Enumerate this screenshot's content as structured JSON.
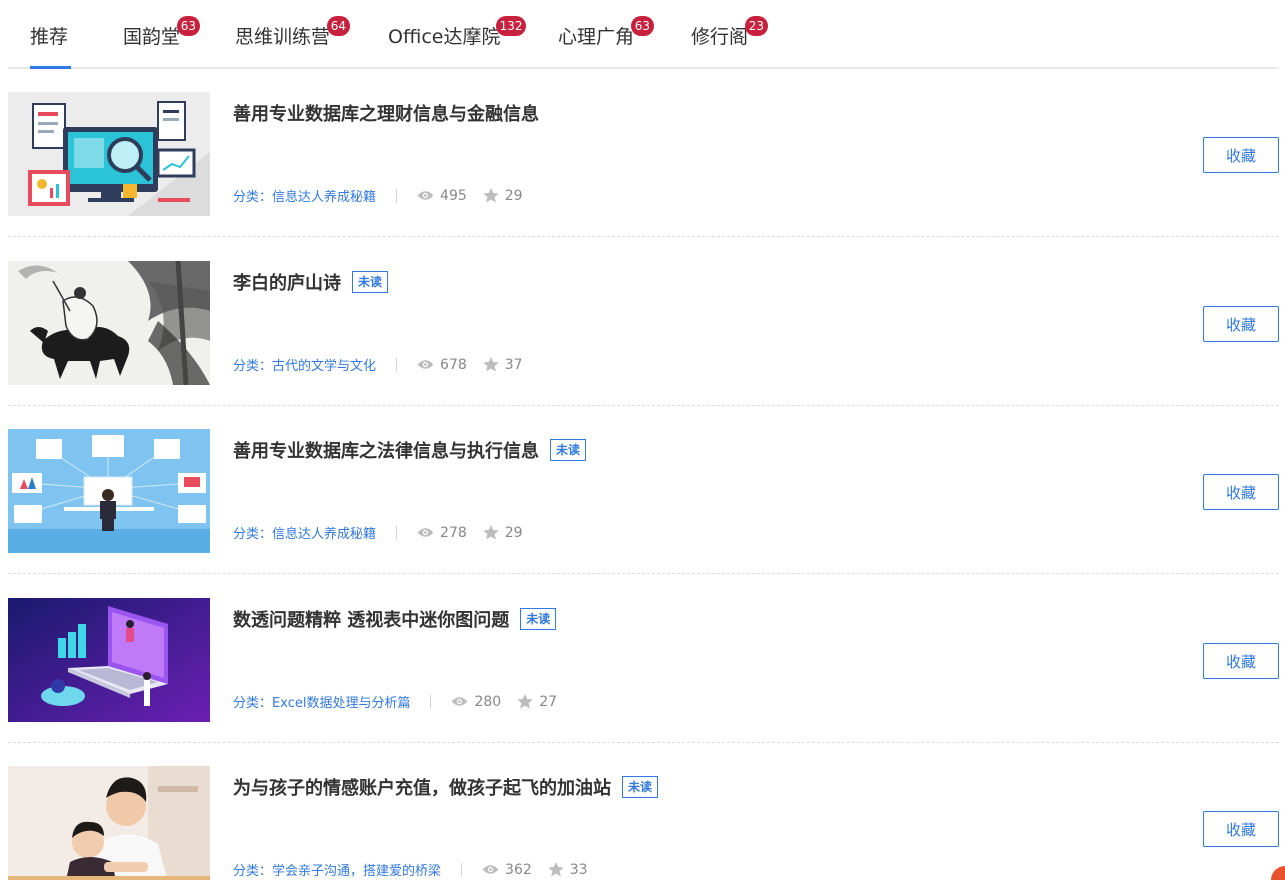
{
  "tabs": [
    {
      "label": "推荐",
      "badge": ""
    },
    {
      "label": "国韵堂",
      "badge": "63"
    },
    {
      "label": "思维训练营",
      "badge": "64"
    },
    {
      "label": "Office达摩院",
      "badge": "132"
    },
    {
      "label": "心理广角",
      "badge": "63"
    },
    {
      "label": "修行阁",
      "badge": "23"
    }
  ],
  "active_tab": "推荐",
  "accent_color": "#3279e3",
  "badge_color": "#c8213d",
  "icons": {
    "views": "eye-icon",
    "favorites": "star-icon"
  },
  "articles": [
    {
      "title": "善用专业数据库之理财信息与金融信息",
      "unread_label": "",
      "category_label": "分类：",
      "category": "信息达人养成秘籍",
      "views": "495",
      "favorites": "29",
      "button": "收藏"
    },
    {
      "title": "李白的庐山诗",
      "unread_label": "未读",
      "category_label": "分类：",
      "category": "古代的文学与文化",
      "views": "678",
      "favorites": "37",
      "button": "收藏"
    },
    {
      "title": "善用专业数据库之法律信息与执行信息",
      "unread_label": "未读",
      "category_label": "分类：",
      "category": "信息达人养成秘籍",
      "views": "278",
      "favorites": "29",
      "button": "收藏"
    },
    {
      "title": "数透问题精粹 透视表中迷你图问题",
      "unread_label": "未读",
      "category_label": "分类：",
      "category": "Excel数据处理与分析篇",
      "views": "280",
      "favorites": "27",
      "button": "收藏"
    },
    {
      "title": "为与孩子的情感账户充值，做孩子起飞的加油站",
      "unread_label": "未读",
      "category_label": "分类：",
      "category": "学会亲子沟通，搭建爱的桥梁",
      "views": "362",
      "favorites": "33",
      "button": "收藏"
    }
  ]
}
